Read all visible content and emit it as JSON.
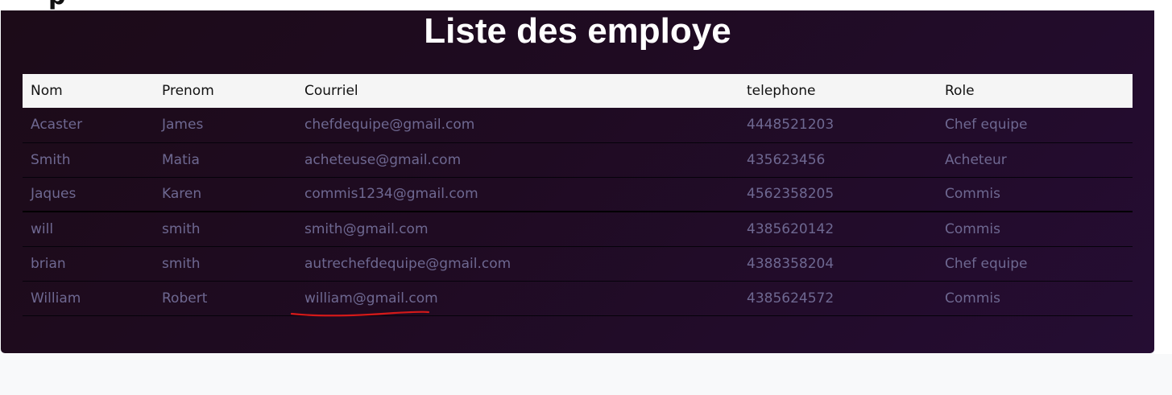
{
  "page": {
    "title": "Liste des employe"
  },
  "table": {
    "headers": {
      "nom": "Nom",
      "prenom": "Prenom",
      "courriel": "Courriel",
      "telephone": "telephone",
      "role": "Role"
    },
    "rows": [
      {
        "nom": "Acaster",
        "prenom": "James",
        "courriel": "chefdequipe@gmail.com",
        "telephone": "4448521203",
        "role": "Chef equipe"
      },
      {
        "nom": "Smith",
        "prenom": "Matia",
        "courriel": "acheteuse@gmail.com",
        "telephone": "435623456",
        "role": "Acheteur"
      },
      {
        "nom": "Jaques",
        "prenom": "Karen",
        "courriel": "commis1234@gmail.com",
        "telephone": "4562358205",
        "role": "Commis"
      },
      {
        "nom": "will",
        "prenom": "smith",
        "courriel": "smith@gmail.com",
        "telephone": "4385620142",
        "role": "Commis"
      },
      {
        "nom": "brian",
        "prenom": "smith",
        "courriel": "autrechefdequipe@gmail.com",
        "telephone": "4388358204",
        "role": "Chef equipe"
      },
      {
        "nom": "William",
        "prenom": "Robert",
        "courriel": "william@gmail.com",
        "telephone": "4385624572",
        "role": "Commis"
      }
    ]
  },
  "colors": {
    "panel_background": "#1f0b22",
    "header_background": "#f5f5f5",
    "cell_text": "#6e6891",
    "annotation": "#d41919"
  }
}
